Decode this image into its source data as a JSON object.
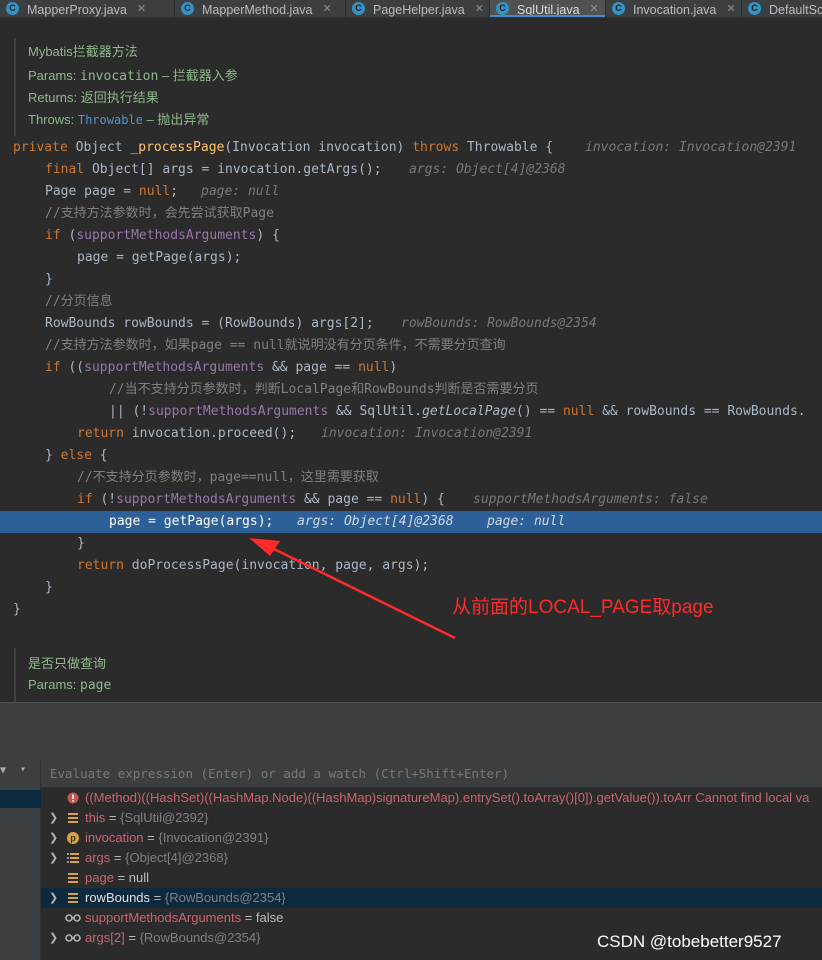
{
  "tabs": [
    {
      "label": "MapperProxy.java",
      "active": false
    },
    {
      "label": "MapperMethod.java",
      "active": false
    },
    {
      "label": "PageHelper.java",
      "active": false
    },
    {
      "label": "SqlUtil.java",
      "active": true
    },
    {
      "label": "Invocation.java",
      "active": false
    },
    {
      "label": "DefaultSc",
      "active": false
    }
  ],
  "doc_top": {
    "title": "Mybatis拦截器方法",
    "params_key": "Params:",
    "params_name": "invocation",
    "params_desc": "– 拦截器入参",
    "returns_key": "Returns:",
    "returns_desc": "返回执行结果",
    "throws_key": "Throws:",
    "throws_name": "Throwable",
    "throws_desc": "– 抛出异常"
  },
  "code": {
    "l1_private": "private",
    "l1_object": "Object",
    "l1_method": "_processPage",
    "l1_params": "(Invocation invocation)",
    "l1_throws": "throws",
    "l1_type": "Throwable {",
    "l1_hint": "invocation: Invocation@2391",
    "l2_final": "final",
    "l2_code": "Object[] args = invocation.getArgs();",
    "l2_hint": "args: Object[4]@2368",
    "l3_code": "Page page = ",
    "l3_null": "null",
    "l3_semi": ";",
    "l3_hint": "page: null",
    "l4_comment": "//支持方法参数时，会先尝试获取Page",
    "l5_if": "if",
    "l5_open": " (",
    "l5_field": "supportMethodsArguments",
    "l5_close": ") {",
    "l6_code": "page = getPage(args);",
    "l7_code": "}",
    "l8_comment": "//分页信息",
    "l9_code": "RowBounds rowBounds = (RowBounds) args[2];",
    "l9_hint": "rowBounds: RowBounds@2354",
    "l10_comment": "//支持方法参数时，如果page == null就说明没有分页条件，不需要分页查询",
    "l11_if": "if",
    "l11_open": " ((",
    "l11_field": "supportMethodsArguments",
    "l11_mid": " && page == ",
    "l11_null": "null",
    "l11_close": ")",
    "l12_comment": "//当不支持分页参数时，判断LocalPage和RowBounds判断是否需要分页",
    "l13_a": "|| (!",
    "l13_field": "supportMethodsArguments",
    "l13_b": " && SqlUtil.",
    "l13_method": "getLocalPage",
    "l13_c": "() == ",
    "l13_null": "null",
    "l13_d": " && rowBounds == RowBounds.",
    "l14_return": "return",
    "l14_code": " invocation.proceed();",
    "l14_hint": "invocation: Invocation@2391",
    "l15_close": "} ",
    "l15_else": "else",
    "l15_open": " {",
    "l16_comment": "//不支持分页参数时，page==null，这里需要获取",
    "l17_if": "if",
    "l17_open": " (!",
    "l17_field": "supportMethodsArguments",
    "l17_mid": " && page == ",
    "l17_null": "null",
    "l17_close": ") {",
    "l17_hint": "supportMethodsArguments: false",
    "l18_code": "page = getPage(args);",
    "l18_hint1": "args: Object[4]@2368",
    "l18_hint2": "page: null",
    "l19_code": "}",
    "l20_return": "return",
    "l20_code": " doProcessPage(invocation, page, args);",
    "l21_code": "}",
    "l22_code": "}"
  },
  "annotation": "从前面的LOCAL_PAGE取page",
  "doc_bottom": {
    "title": "是否只做查询",
    "params_key": "Params:",
    "params_name": "page"
  },
  "debugger": {
    "eval_placeholder": "Evaluate expression (Enter) or add a watch (Ctrl+Shift+Enter)",
    "error_expr": "((Method)((HashSet)((HashMap.Node)((HashMap)signatureMap).entrySet().toArray()[0]).getValue()).toArr",
    "error_msg": "Cannot find local va",
    "variables": [
      {
        "name": "this",
        "value": "{SqlUtil@2392}",
        "icon": "field-icon",
        "expandable": true
      },
      {
        "name": "invocation",
        "value": "{Invocation@2391}",
        "icon": "parameter-icon",
        "expandable": true
      },
      {
        "name": "args",
        "value": "{Object[4]@2368}",
        "icon": "array-icon",
        "expandable": true
      },
      {
        "name": "page",
        "value": "null",
        "icon": "field-icon",
        "expandable": false
      },
      {
        "name": "rowBounds",
        "value": "{RowBounds@2354}",
        "icon": "field-icon",
        "expandable": true
      },
      {
        "name": "supportMethodsArguments",
        "value": "false",
        "icon": "watch-icon",
        "expandable": false
      },
      {
        "name": "args[2]",
        "value": "{RowBounds@2354}",
        "icon": "watch-icon",
        "expandable": true
      }
    ]
  },
  "watermark": "CSDN @tobebetter9527"
}
